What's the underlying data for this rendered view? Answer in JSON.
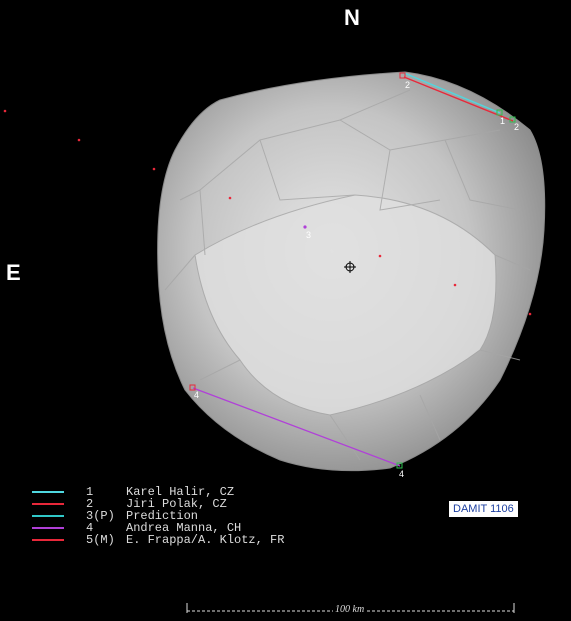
{
  "directions": {
    "north": "N",
    "east": "E"
  },
  "chords": [
    {
      "id": "1",
      "color": "#4fd8e0"
    },
    {
      "id": "2",
      "color": "#e8283a"
    },
    {
      "id": "4",
      "color": "#b040d8"
    }
  ],
  "chord_labels": [
    "2",
    "1",
    "2",
    "4",
    "4",
    "3"
  ],
  "legend": [
    {
      "num": "1",
      "observer": "Karel Halir, CZ",
      "color": "#4fd8e0"
    },
    {
      "num": "2",
      "observer": "Jiri Polak, CZ",
      "color": "#e8283a"
    },
    {
      "num": "3(P)",
      "observer": "Prediction",
      "color": "#30c8c8"
    },
    {
      "num": "4",
      "observer": "Andrea Manna, CH",
      "color": "#b040d8"
    },
    {
      "num": "5(M)",
      "observer": "E. Frappa/A. Klotz, FR",
      "color": "#e8283a"
    }
  ],
  "badge": "DAMIT 1106",
  "scale_label": "100 km",
  "colors": {
    "background": "#000000",
    "model_shade": "#c8c8c8",
    "highlight": "#e8e8e8"
  }
}
